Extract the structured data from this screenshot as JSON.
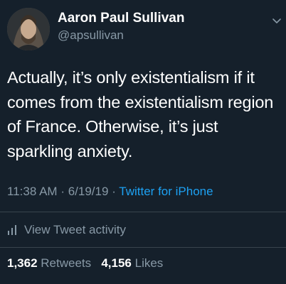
{
  "tweet": {
    "author": {
      "display_name": "Aaron Paul Sullivan",
      "handle": "@apsullivan"
    },
    "text": "Actually, it’s only existentialism if it comes from the existentialism region of France. Otherwise, it’s just sparkling anxiety.",
    "time": "11:38 AM",
    "date": "6/19/19",
    "separator": "·",
    "source": "Twitter for iPhone",
    "activity_label": "View Tweet activity",
    "stats": {
      "retweets_count": "1,362",
      "retweets_label": "Retweets",
      "likes_count": "4,156",
      "likes_label": "Likes"
    }
  },
  "colors": {
    "background": "#15202b",
    "text_primary": "#ffffff",
    "text_secondary": "#8899a6",
    "link": "#1da1f2",
    "divider": "#38444d"
  },
  "icons": {
    "caret": "chevron-down-icon",
    "activity": "bar-chart-icon"
  }
}
